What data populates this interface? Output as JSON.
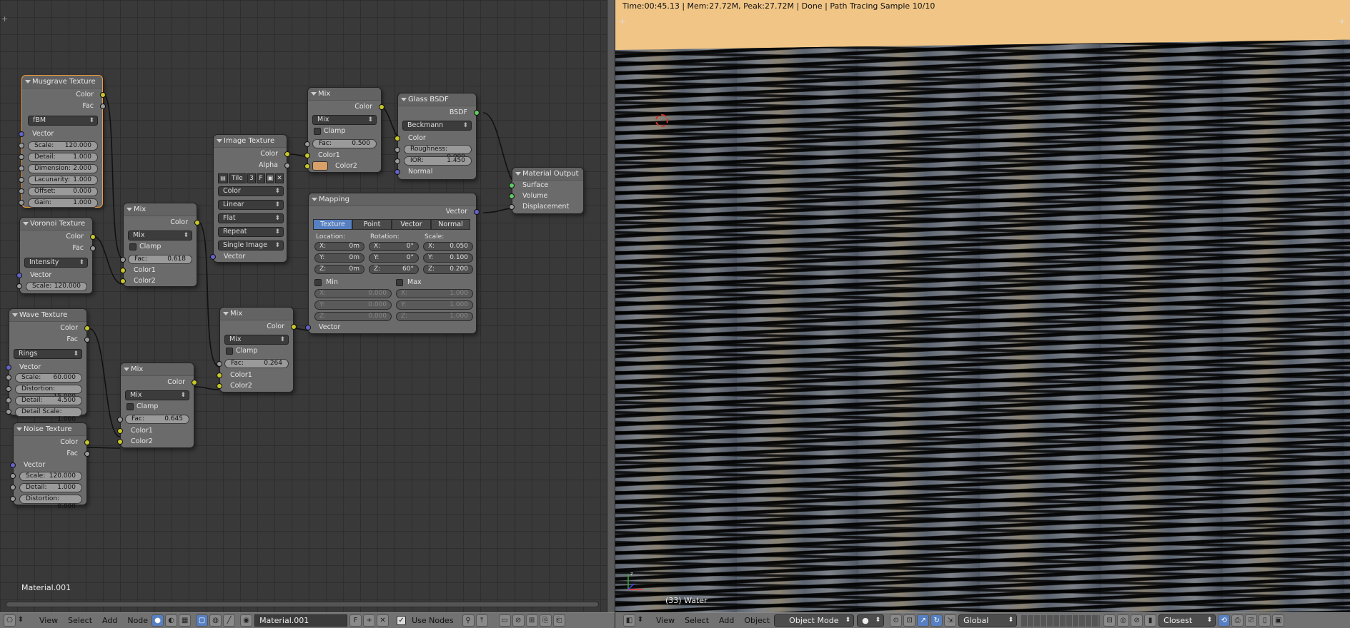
{
  "node_editor": {
    "material_label": "Material.001",
    "nodes": {
      "musgrave": {
        "title": "Musgrave Texture",
        "out_color": "Color",
        "out_fac": "Fac",
        "type": "fBM",
        "in_vector": "Vector",
        "fields": [
          {
            "k": "Scale:",
            "v": "120.000"
          },
          {
            "k": "Detail:",
            "v": "1.000"
          },
          {
            "k": "Dimension:",
            "v": "2.000"
          },
          {
            "k": "Lacunarity:",
            "v": "1.000"
          },
          {
            "k": "Offset:",
            "v": "0.000"
          },
          {
            "k": "Gain:",
            "v": "1.000"
          }
        ]
      },
      "voronoi": {
        "title": "Voronoi Texture",
        "out_color": "Color",
        "out_fac": "Fac",
        "coloring": "Intensity",
        "in_vector": "Vector",
        "scale_k": "Scale:",
        "scale_v": "120.000"
      },
      "wave": {
        "title": "Wave Texture",
        "out_color": "Color",
        "out_fac": "Fac",
        "type": "Rings",
        "in_vector": "Vector",
        "fields": [
          {
            "k": "Scale:",
            "v": "60.000"
          },
          {
            "k": "Distortion:",
            "v": "15.000"
          },
          {
            "k": "Detail:",
            "v": "4.500"
          },
          {
            "k": "Detail Scale:",
            "v": "1.000"
          }
        ]
      },
      "noise": {
        "title": "Noise Texture",
        "out_color": "Color",
        "out_fac": "Fac",
        "in_vector": "Vector",
        "fields": [
          {
            "k": "Scale:",
            "v": "120.000"
          },
          {
            "k": "Detail:",
            "v": "1.000"
          },
          {
            "k": "Distortion:",
            "v": "0.000"
          }
        ]
      },
      "mix1": {
        "title": "Mix",
        "out": "Color",
        "blend": "Mix",
        "clamp": "Clamp",
        "fac_k": "Fac:",
        "fac_v": "0.618",
        "c1": "Color1",
        "c2": "Color2"
      },
      "mix2": {
        "title": "Mix",
        "out": "Color",
        "blend": "Mix",
        "clamp": "Clamp",
        "fac_k": "Fac:",
        "fac_v": "0.645",
        "c1": "Color1",
        "c2": "Color2"
      },
      "mix3": {
        "title": "Mix",
        "out": "Color",
        "blend": "Mix",
        "clamp": "Clamp",
        "fac_k": "Fac:",
        "fac_v": "0.264",
        "c1": "Color1",
        "c2": "Color2"
      },
      "mix4": {
        "title": "Mix",
        "out": "Color",
        "blend": "Mix",
        "clamp": "Clamp",
        "fac_k": "Fac:",
        "fac_v": "0.500",
        "c1": "Color1",
        "c2": "Color2",
        "color2": "#d9a068"
      },
      "image": {
        "title": "Image Texture",
        "out_color": "Color",
        "out_alpha": "Alpha",
        "tile_label": "Tile",
        "tile_num": "3",
        "tile_f": "F",
        "color_space": "Color",
        "interp": "Linear",
        "proj": "Flat",
        "ext": "Repeat",
        "source": "Single Image",
        "in_vector": "Vector"
      },
      "glass": {
        "title": "Glass BSDF",
        "out": "BSDF",
        "distribution": "Beckmann",
        "in_color": "Color",
        "rough_k": "Roughness:",
        "rough_v": "0.000",
        "ior_k": "IOR:",
        "ior_v": "1.450",
        "in_normal": "Normal"
      },
      "output": {
        "title": "Material Output",
        "surface": "Surface",
        "volume": "Volume",
        "displacement": "Displacement"
      },
      "mapping": {
        "title": "Mapping",
        "out": "Vector",
        "tabs": [
          "Texture",
          "Point",
          "Vector",
          "Normal"
        ],
        "loc_lbl": "Location:",
        "rot_lbl": "Rotation:",
        "scale_lbl": "Scale:",
        "loc": [
          {
            "k": "X:",
            "v": "0m"
          },
          {
            "k": "Y:",
            "v": "0m"
          },
          {
            "k": "Z:",
            "v": "0m"
          }
        ],
        "rot": [
          {
            "k": "X:",
            "v": "0°"
          },
          {
            "k": "Y:",
            "v": "0°"
          },
          {
            "k": "Z:",
            "v": "60°"
          }
        ],
        "scale": [
          {
            "k": "X:",
            "v": "0.050"
          },
          {
            "k": "Y:",
            "v": "0.100"
          },
          {
            "k": "Z:",
            "v": "0.200"
          }
        ],
        "min_lbl": "Min",
        "max_lbl": "Max",
        "min": [
          {
            "k": "X:",
            "v": "0.000"
          },
          {
            "k": "Y:",
            "v": "0.000"
          },
          {
            "k": "Z:",
            "v": "0.000"
          }
        ],
        "max": [
          {
            "k": "X:",
            "v": "1.000"
          },
          {
            "k": "Y:",
            "v": "1.000"
          },
          {
            "k": "Z:",
            "v": "1.000"
          }
        ],
        "in_vector": "Vector"
      }
    },
    "header": {
      "view": "View",
      "select": "Select",
      "add": "Add",
      "node": "Node",
      "material": "Material.001",
      "fake": "F",
      "use_nodes": "Use Nodes"
    }
  },
  "viewport": {
    "status": "Time:00:45.13 | Mem:27.72M, Peak:27.72M | Done | Path Tracing Sample 10/10",
    "object_label": "(33) Water",
    "header": {
      "view": "View",
      "select": "Select",
      "add": "Add",
      "object": "Object",
      "mode": "Object Mode",
      "orientation": "Global",
      "snap": "Closest"
    },
    "sky_color": "#f0c586"
  }
}
